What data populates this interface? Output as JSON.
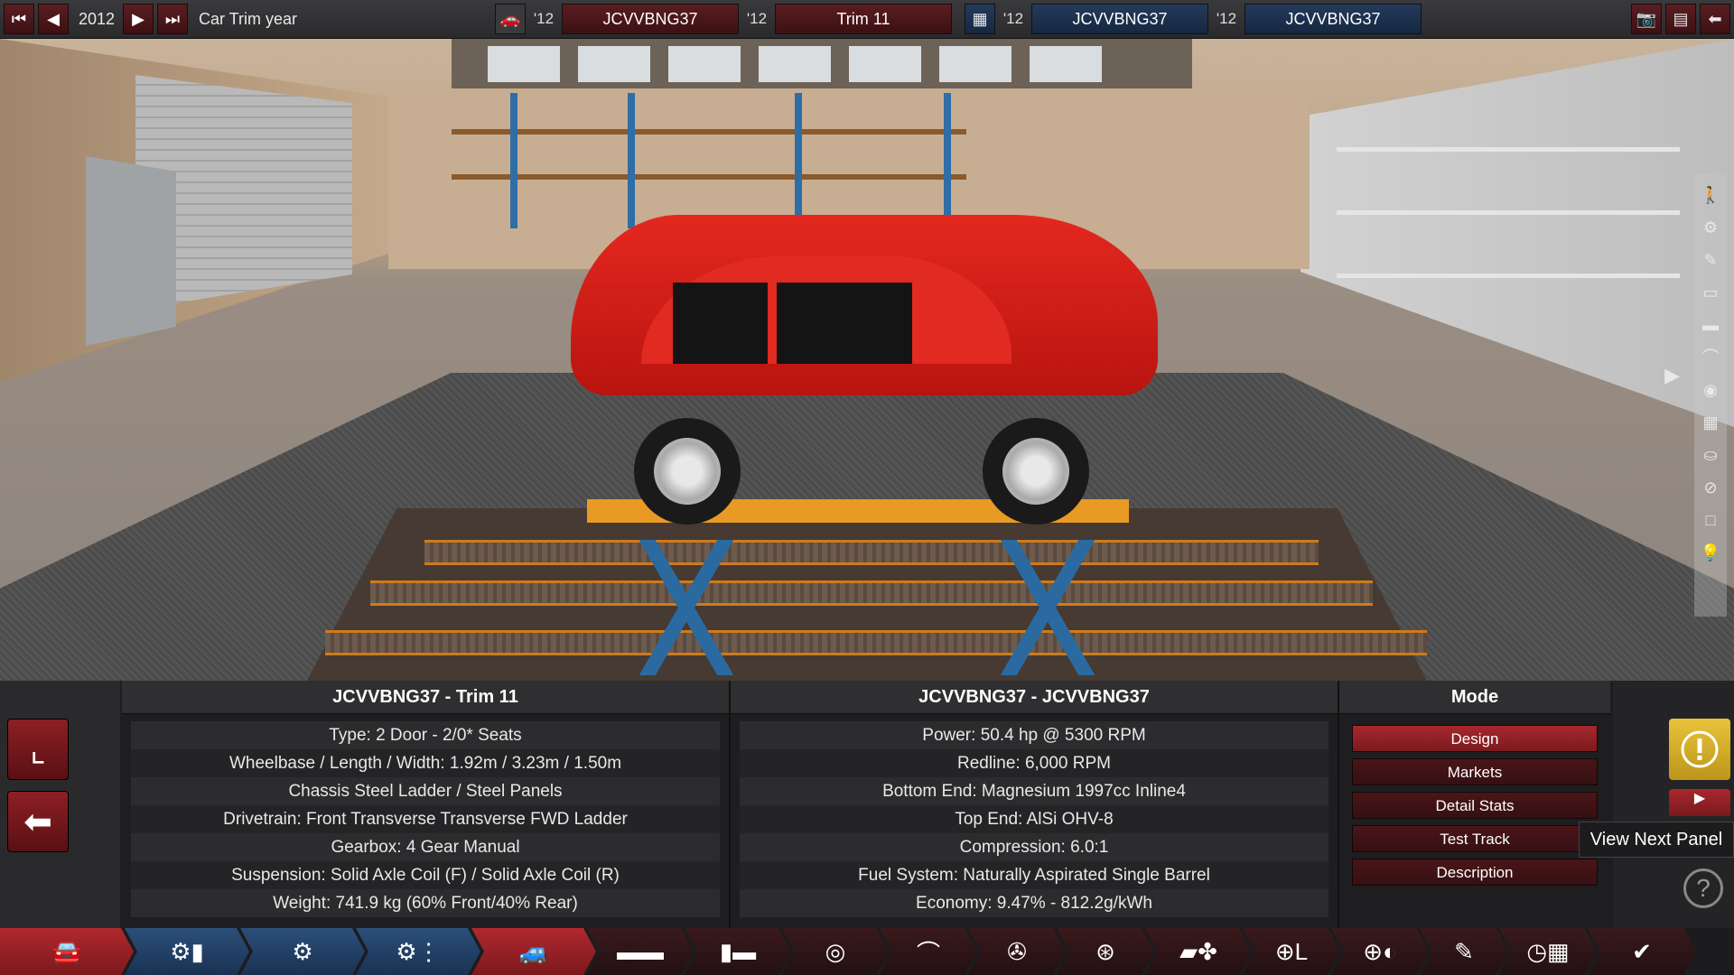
{
  "topbar": {
    "year": "2012",
    "year_label": "Car Trim year",
    "model_year": "'12",
    "model_name": "JCVVBNG37",
    "trim_year": "'12",
    "trim_name": "Trim 11",
    "engine_family_year": "'12",
    "engine_family_name": "JCVVBNG37",
    "engine_variant_year": "'12",
    "engine_variant_name": "JCVVBNG37"
  },
  "car_panel": {
    "title": "JCVVBNG37 - Trim 11",
    "rows": [
      "Type: 2 Door - 2/0* Seats",
      "Wheelbase / Length / Width: 1.92m / 3.23m / 1.50m",
      "Chassis Steel Ladder / Steel Panels",
      "Drivetrain: Front Transverse Transverse FWD Ladder",
      "Gearbox: 4 Gear Manual",
      "Suspension: Solid Axle Coil (F) / Solid Axle Coil (R)",
      "Weight: 741.9 kg (60% Front/40% Rear)"
    ]
  },
  "engine_panel": {
    "title": "JCVVBNG37 - JCVVBNG37",
    "rows": [
      "Power: 50.4 hp @ 5300 RPM",
      "Redline:  6,000 RPM",
      "Bottom End: Magnesium 1997cc Inline4",
      "Top End: AlSi OHV-8",
      "Compression: 6.0:1",
      "Fuel System: Naturally Aspirated Single Barrel",
      "Economy: 9.47% - 812.2g/kWh"
    ]
  },
  "mode_panel": {
    "title": "Mode",
    "buttons": [
      "Design",
      "Markets",
      "Detail Stats",
      "Test Track",
      "Description"
    ],
    "active": "Design"
  },
  "tooltip": "View Next Panel",
  "colors": {
    "accent_red": "#a7282d",
    "accent_blue": "#2b4f7a",
    "warning_yellow": "#e8c33a"
  },
  "icons": {
    "topbar": [
      "first-icon",
      "prev-icon",
      "next-icon",
      "last-icon",
      "car-model-icon",
      "engine-icon",
      "camera-icon",
      "table-icon",
      "back-icon"
    ],
    "side_toolbar": [
      "person-icon",
      "wheel-icon",
      "paint-icon",
      "fixture-icon",
      "trim-icon",
      "roof-icon",
      "light-icon",
      "grille-icon",
      "seat-icon",
      "tire-icon",
      "square-icon",
      "bulb-icon"
    ],
    "nav": [
      "car-icon",
      "engine-block-icon",
      "engine-icon",
      "engine-family-icon",
      "car-trim-icon",
      "chassis-icon",
      "gearbox-icon",
      "turbo-icon",
      "fuel-icon",
      "wheels-icon",
      "exhaust-icon",
      "aero-icon",
      "steering-icon",
      "tire-rim-icon",
      "paint-icon",
      "performance-icon",
      "done-icon"
    ]
  }
}
